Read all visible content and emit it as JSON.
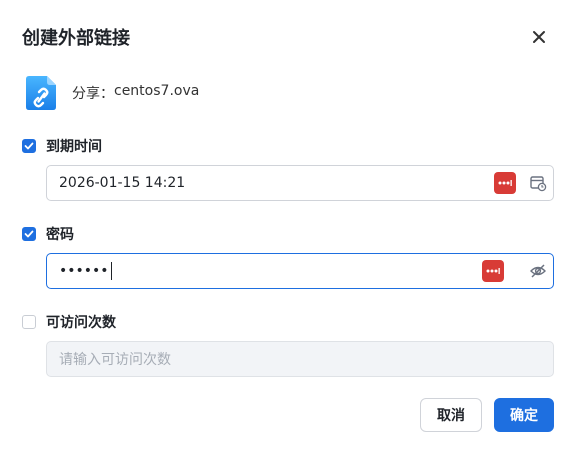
{
  "dialog": {
    "title": "创建外部链接",
    "close_icon": "close-icon"
  },
  "share": {
    "icon": "link-file-icon",
    "prefix": "分享：",
    "filename": "centos7.ova"
  },
  "expire": {
    "checked": true,
    "label": "到期时间",
    "value": "2026-01-15 14:21",
    "password_manager_icon": "password-manager-icon",
    "calendar_icon": "calendar-clock-icon"
  },
  "password": {
    "checked": true,
    "label": "密码",
    "value": "••••••",
    "password_manager_icon": "password-manager-icon",
    "visibility_icon": "eye-off-icon"
  },
  "visits": {
    "checked": false,
    "label": "可访问次数",
    "placeholder": "请输入可访问次数"
  },
  "buttons": {
    "cancel": "取消",
    "ok": "确定"
  },
  "colors": {
    "primary": "#1e6fe0",
    "password_manager": "#d83b36"
  }
}
